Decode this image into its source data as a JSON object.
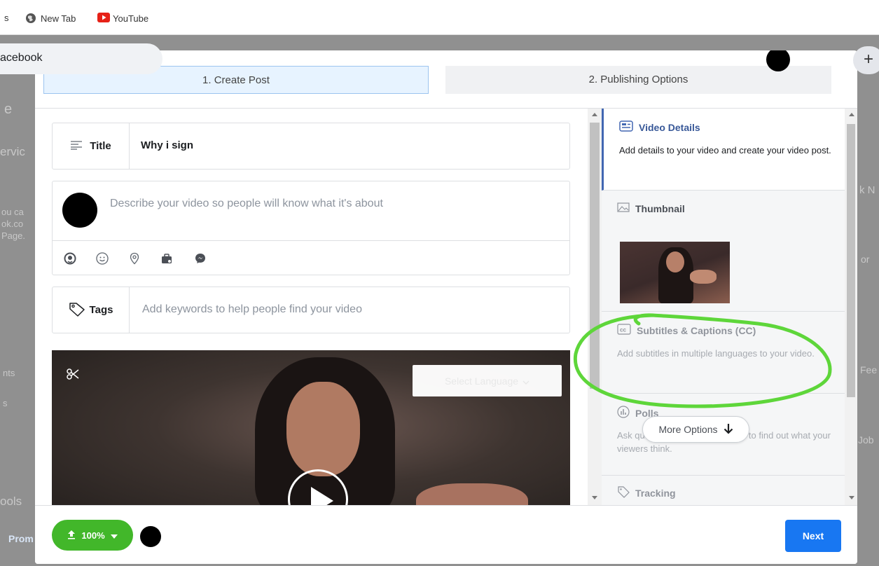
{
  "browser": {
    "bookmarks": [
      {
        "label": "s",
        "icon": "none"
      },
      {
        "label": "New Tab",
        "icon": "globe-icon"
      },
      {
        "label": "YouTube",
        "icon": "youtube-icon"
      }
    ]
  },
  "background_page": {
    "tab_label": "acebook",
    "plus_label": "+",
    "fragments": [
      "e",
      "ervic",
      "ou ca",
      "ok.co",
      "Page.",
      "nts",
      "s",
      "ools",
      "Prom",
      "k N",
      "or",
      "Fee",
      "Job"
    ]
  },
  "modal": {
    "tabs": [
      {
        "label": "1. Create Post",
        "active": true
      },
      {
        "label": "2. Publishing Options",
        "active": false
      }
    ],
    "title_field": {
      "label": "Title",
      "value": "Why i sign"
    },
    "description": {
      "placeholder": "Describe your video so people will know what it's about"
    },
    "description_icons": [
      "emoji-sticker-icon",
      "smiley-icon",
      "location-pin-icon",
      "briefcase-icon",
      "messenger-icon"
    ],
    "tags_field": {
      "label": "Tags",
      "placeholder": "Add keywords to help people find your video"
    },
    "video_player": {
      "language_select": "Select Language"
    },
    "options": [
      {
        "title": "Video Details",
        "description": "Add details to your video and create your video post.",
        "icon": "video-details-icon"
      },
      {
        "title": "Thumbnail",
        "icon": "image-icon"
      },
      {
        "title": "Subtitles & Captions (CC)",
        "description": "Add subtitles in multiple languages to your video.",
        "icon": "cc-icon"
      },
      {
        "title": "Polls",
        "description": "Ask questions during your video to find out what your viewers think.",
        "icon": "poll-icon"
      },
      {
        "title": "Tracking",
        "icon": "tag-icon"
      }
    ],
    "more_options_label": "More Options",
    "footer": {
      "upload_progress_label": "100%",
      "next_label": "Next"
    }
  },
  "colors": {
    "accent": "#1877f2",
    "upload_green": "#42b72a",
    "annotation_green": "#5ed63a",
    "active_tab_bg": "#e7f3ff"
  }
}
